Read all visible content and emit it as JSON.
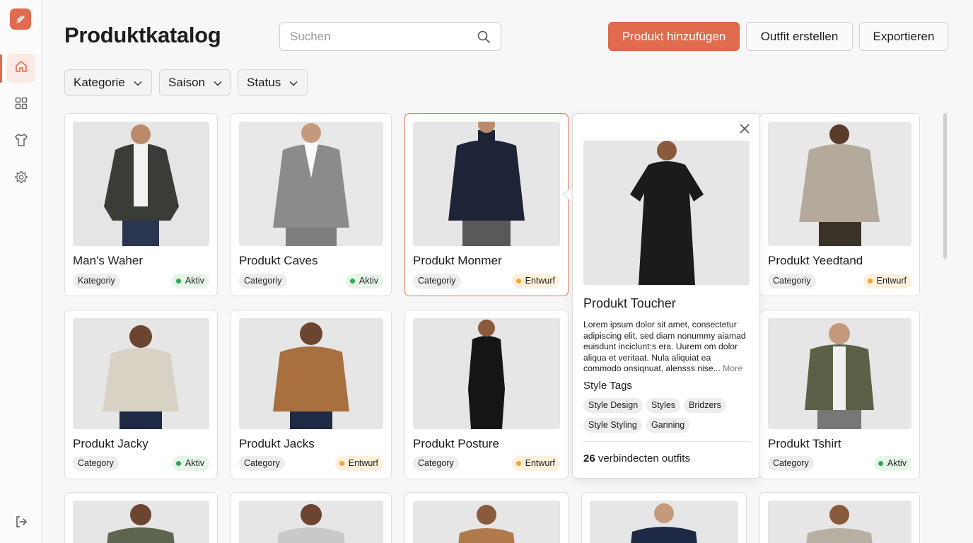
{
  "app": {
    "title": "Produktkatalog"
  },
  "search": {
    "placeholder": "Suchen",
    "value": ""
  },
  "actions": {
    "add_product": "Produkt hinzufügen",
    "create_outfit": "Outfit erstellen",
    "export": "Exportieren"
  },
  "filters": [
    {
      "label": "Kategorie"
    },
    {
      "label": "Saison"
    },
    {
      "label": "Status"
    }
  ],
  "sidebar": {
    "items": [
      {
        "icon": "home-icon",
        "active": true
      },
      {
        "icon": "grid-icon",
        "active": false
      },
      {
        "icon": "shirt-icon",
        "active": false
      },
      {
        "icon": "gear-icon",
        "active": false
      }
    ],
    "bottom_icon": "logout-icon"
  },
  "products": [
    {
      "name": "Man's Waher",
      "category": "Kategoriy",
      "status": "Aktiv"
    },
    {
      "name": "Produkt Caves",
      "category": "Categoriy",
      "status": "Aktiv"
    },
    {
      "name": "Produkt Monmer",
      "category": "Categoriy",
      "status": "Entwurf"
    },
    {
      "name": "Produkt Yeedtand",
      "category": "Categoriy",
      "status": "Entwurf"
    },
    {
      "name": "Produkt Jacky",
      "category": "Category",
      "status": "Aktiv"
    },
    {
      "name": "Produkt Jacks",
      "category": "Category",
      "status": "Entwurf"
    },
    {
      "name": "Produkt Posture",
      "category": "Category",
      "status": "Entwurf"
    },
    {
      "name": "Produkt Tshirt",
      "category": "Category",
      "status": "Aktiv"
    }
  ],
  "popover": {
    "title": "Produkt Toucher",
    "description": "Lorem ipsum dolor sit amet, consectetur adipiscing elit, sed diam nonummy aiamad euisdunt inciclunt:s era. Uurem om dolor aliqua et veritaat. Nula aliquiat ea commodo onsiqnuat, alensss nise...",
    "more_label": "More",
    "tags_title": "Style Tags",
    "tags": [
      "Style Design",
      "Styles",
      "Bridzers",
      "Style Styling",
      "Ganning"
    ],
    "outfits_count": "26",
    "outfits_label": "verbindecten outfits"
  },
  "colors": {
    "accent": "#e06b4f",
    "status_aktiv": "#2ea84f",
    "status_entwurf": "#f2a533"
  }
}
